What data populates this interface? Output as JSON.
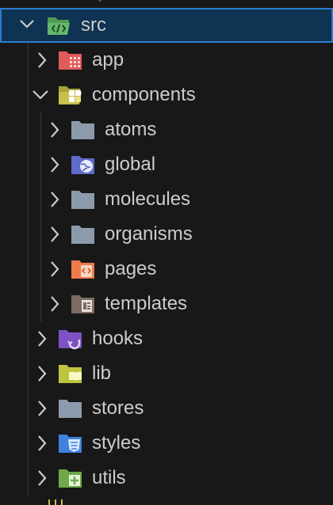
{
  "explorer": {
    "root": {
      "label": "src",
      "expanded": true,
      "icon": "folder-src-open-icon"
    },
    "items": [
      {
        "label": "app",
        "icon": "folder-app-icon",
        "color": "#e05a5a"
      },
      {
        "label": "components",
        "icon": "folder-components-open-icon",
        "color": "#c8c04a"
      },
      {
        "label": "atoms",
        "icon": "folder-icon",
        "color": "#8b9bab"
      },
      {
        "label": "global",
        "icon": "folder-global-icon",
        "color": "#6f7fe0"
      },
      {
        "label": "molecules",
        "icon": "folder-icon",
        "color": "#8b9bab"
      },
      {
        "label": "organisms",
        "icon": "folder-icon",
        "color": "#8b9bab"
      },
      {
        "label": "pages",
        "icon": "folder-pages-icon",
        "color": "#ee7a4a"
      },
      {
        "label": "templates",
        "icon": "folder-templates-icon",
        "color": "#8d7468"
      },
      {
        "label": "hooks",
        "icon": "folder-hooks-icon",
        "color": "#8a5cd0"
      },
      {
        "label": "lib",
        "icon": "folder-lib-icon",
        "color": "#c8cc44"
      },
      {
        "label": "stores",
        "icon": "folder-icon",
        "color": "#8b9bab"
      },
      {
        "label": "styles",
        "icon": "folder-styles-icon",
        "color": "#4a8ce6"
      },
      {
        "label": "utils",
        "icon": "folder-utils-icon",
        "color": "#7cb451"
      }
    ]
  },
  "colors": {
    "background": "#181818",
    "selection": "#0f3352",
    "selection_border": "#2c7ccf",
    "text": "#cccccc"
  }
}
